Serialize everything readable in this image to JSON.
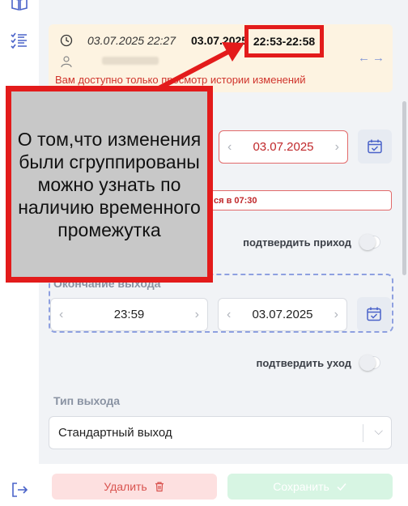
{
  "rail": {
    "icons": [
      "book-icon",
      "checklist-icon",
      "logout-icon"
    ]
  },
  "notice": {
    "date_left": "03.07.2025 22:27",
    "date_right": "03.07.2025",
    "time_range": "22:53-22:58",
    "message": "Вам доступно только просмотр истории изменений",
    "arrows": "←→"
  },
  "arrival": {
    "date_value": "03.07.2025",
    "error_text": "ся в 07:30",
    "confirm_label": "подтвердить приход"
  },
  "departure": {
    "label": "Окончание выхода",
    "time_value": "23:59",
    "date_value": "03.07.2025",
    "confirm_label": "подтвердить уход"
  },
  "exit_type": {
    "label": "Тип выхода",
    "value": "Стандартный выход"
  },
  "actions": {
    "delete_label": "Удалить",
    "save_label": "Сохранить"
  },
  "annotation": {
    "text": "О том,что изменения были сгруппированы можно узнать по наличию временного промежутка"
  },
  "colors": {
    "highlight": "#e31b1b",
    "notice_bg": "#fdf3e1",
    "error": "#c0282b",
    "accent": "#8ea0e0"
  }
}
